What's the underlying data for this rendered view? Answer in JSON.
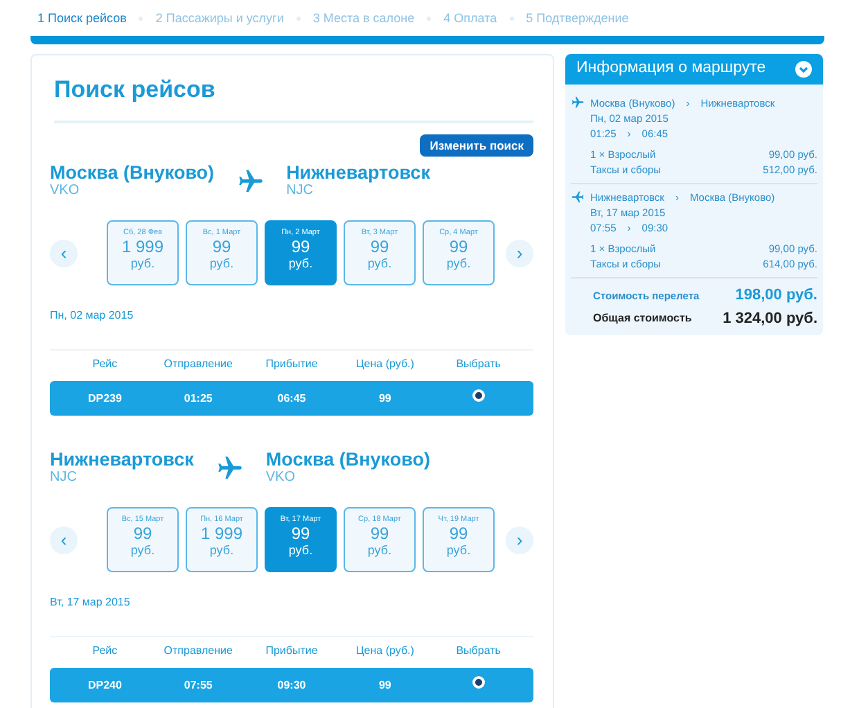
{
  "steps": [
    {
      "label": "1 Поиск рейсов",
      "selected": true
    },
    {
      "label": "2 Пассажиры и услуги",
      "selected": false
    },
    {
      "label": "3 Места в салоне",
      "selected": false
    },
    {
      "label": "4 Оплата",
      "selected": false
    },
    {
      "label": "5 Подтверждение",
      "selected": false
    }
  ],
  "search": {
    "title": "Поиск рейсов",
    "change_button": "Изменить поиск",
    "legs": [
      {
        "from": "Москва (Внуково)",
        "from_code": "VKO",
        "to": "Нижневартовск",
        "to_code": "NJC",
        "prev": "‹",
        "next": "›",
        "days": [
          {
            "date": "Сб, 28 Фев",
            "price": "1 999",
            "currency": "руб.",
            "selected": false
          },
          {
            "date": "Вс, 1 Март",
            "price": "99",
            "currency": "руб.",
            "selected": false
          },
          {
            "date": "Пн, 2 Март",
            "price": "99",
            "currency": "руб.",
            "selected": true
          },
          {
            "date": "Вт, 3 Март",
            "price": "99",
            "currency": "руб.",
            "selected": false
          },
          {
            "date": "Ср, 4 Март",
            "price": "99",
            "currency": "руб.",
            "selected": false
          }
        ],
        "date": "Пн, 02 мар 2015",
        "columns": [
          "Рейс",
          "Отправление",
          "Прибытие",
          "Цена (руб.)",
          "Выбрать"
        ],
        "flights": [
          {
            "cells": [
              "DP239",
              "01:25",
              "06:45",
              "99"
            ],
            "selected": true
          }
        ]
      },
      {
        "from": "Нижневартовск",
        "from_code": "NJC",
        "to": "Москва (Внуково)",
        "to_code": "VKO",
        "prev": "‹",
        "next": "›",
        "days": [
          {
            "date": "Вс, 15 Март",
            "price": "99",
            "currency": "руб.",
            "selected": false
          },
          {
            "date": "Пн, 16 Март",
            "price": "1 999",
            "currency": "руб.",
            "selected": false
          },
          {
            "date": "Вт, 17 Март",
            "price": "99",
            "currency": "руб.",
            "selected": true
          },
          {
            "date": "Ср, 18 Март",
            "price": "99",
            "currency": "руб.",
            "selected": false
          },
          {
            "date": "Чт, 19 Март",
            "price": "99",
            "currency": "руб.",
            "selected": false
          }
        ],
        "date": "Вт, 17 мар 2015",
        "columns": [
          "Рейс",
          "Отправление",
          "Прибытие",
          "Цена (руб.)",
          "Выбрать"
        ],
        "flights": [
          {
            "cells": [
              "DP240",
              "07:55",
              "09:30",
              "99"
            ],
            "selected": true
          }
        ]
      }
    ]
  },
  "route_info": {
    "title": "Информация о маршруте",
    "legs": [
      {
        "kind": "outbound",
        "from": "Москва (Внуково)",
        "to": "Нижневартовск",
        "date": "Пн, 02 мар 2015",
        "depart": "01:25",
        "arrive": "06:45",
        "sep": "›",
        "lines": [
          {
            "label": "1 × Взрослый",
            "amount": "99,00 руб."
          },
          {
            "label": "Таксы и сборы",
            "amount": "512,00 руб."
          }
        ]
      },
      {
        "kind": "return",
        "from": "Нижневартовск",
        "to": "Москва (Внуково)",
        "date": "Вт, 17 мар 2015",
        "depart": "07:55",
        "arrive": "09:30",
        "sep": "›",
        "lines": [
          {
            "label": "1 × Взрослый",
            "amount": "99,00 руб."
          },
          {
            "label": "Таксы и сборы",
            "amount": "614,00 руб."
          }
        ]
      }
    ],
    "fare_label": "Стоимость перелета",
    "fare": "198,00 руб.",
    "total_label": "Общая стоимость",
    "total": "1 324,00 руб."
  }
}
